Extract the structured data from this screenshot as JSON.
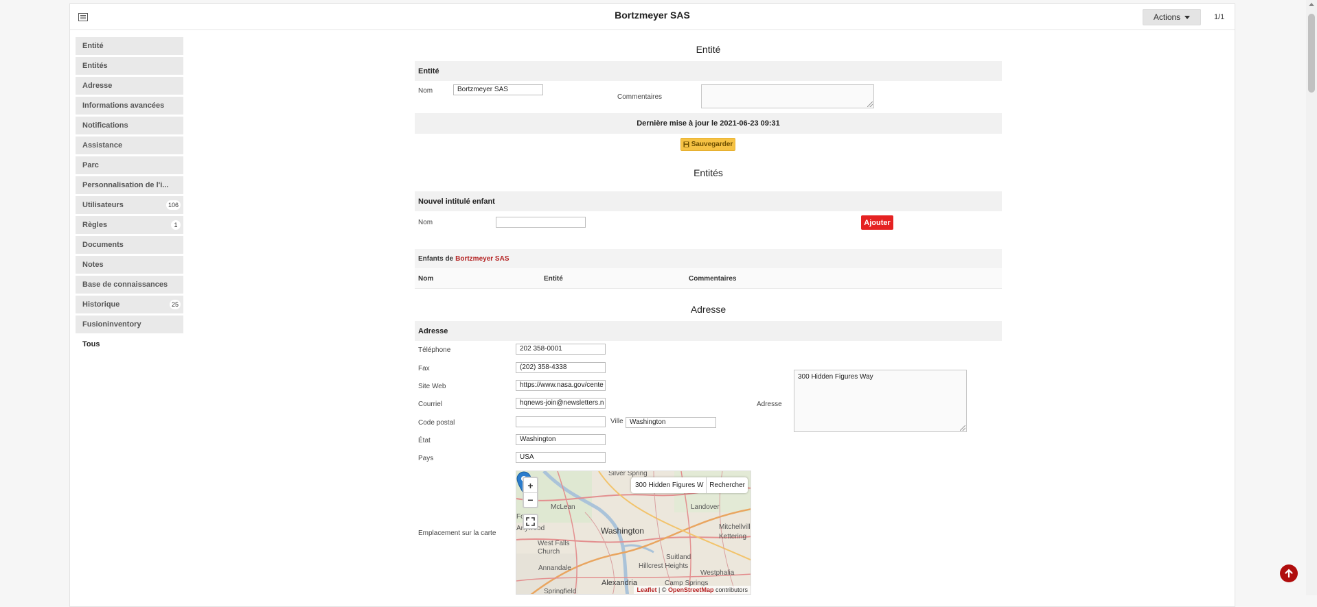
{
  "header": {
    "title": "Bortzmeyer SAS",
    "actions_label": "Actions",
    "pager": "1/1"
  },
  "sidebar": {
    "items": [
      {
        "label": "Entité"
      },
      {
        "label": "Entités"
      },
      {
        "label": "Adresse"
      },
      {
        "label": "Informations avancées"
      },
      {
        "label": "Notifications"
      },
      {
        "label": "Assistance"
      },
      {
        "label": "Parc"
      },
      {
        "label": "Personnalisation de l'i..."
      },
      {
        "label": "Utilisateurs",
        "badge": "106"
      },
      {
        "label": "Règles",
        "badge": "1"
      },
      {
        "label": "Documents"
      },
      {
        "label": "Notes"
      },
      {
        "label": "Base de connaissances"
      },
      {
        "label": "Historique",
        "badge": "25"
      },
      {
        "label": "Fusioninventory"
      },
      {
        "label": "Tous"
      }
    ]
  },
  "entite": {
    "section_title": "Entité",
    "band_label": "Entité",
    "name_label": "Nom",
    "name_value": "Bortzmeyer SAS",
    "comments_label": "Commentaires",
    "comments_value": "",
    "last_update": "Dernière mise à jour le 2021-06-23 09:31",
    "save_label": "Sauvegarder"
  },
  "entites": {
    "section_title": "Entités",
    "band_label": "Nouvel intitulé enfant",
    "name_label": "Nom",
    "name_value": "",
    "add_label": "Ajouter",
    "children_prefix": "Enfants de",
    "children_entity": "Bortzmeyer SAS",
    "columns": [
      "Nom",
      "Entité",
      "Commentaires"
    ]
  },
  "adresse": {
    "section_title": "Adresse",
    "band_label": "Adresse",
    "phone_label": "Téléphone",
    "phone_value": "202 358-0001",
    "fax_label": "Fax",
    "fax_value": "(202) 358-4338",
    "website_label": "Site Web",
    "website_value": "https://www.nasa.gov/cente",
    "email_label": "Courriel",
    "email_value": "hqnews-join@newsletters.n",
    "postal_label": "Code postal",
    "postal_value": "",
    "city_label": "Ville",
    "city_value": "Washington",
    "state_label": "État",
    "state_value": "Washington",
    "country_label": "Pays",
    "country_value": "USA",
    "address_label": "Adresse",
    "address_value": "300 Hidden Figures Way",
    "map_label": "Emplacement sur la carte"
  },
  "map": {
    "search_value": "300 Hidden Figures W",
    "search_button": "Rechercher",
    "zoom_in": "+",
    "zoom_out": "−",
    "attr_leaflet": "Leaflet",
    "attr_sep": " | © ",
    "attr_osm": "OpenStreetMap",
    "attr_suffix": " contributors",
    "places": [
      "Silver Spring",
      "McLean",
      "Landover",
      "Washington",
      "West Falls Church",
      "Mitchellville",
      "Kettering",
      "Suitland",
      "Hillcrest Heights",
      "Annandale",
      "Alexandria",
      "Westphalia",
      "Camp Springs",
      "Springfield",
      "Arlywood",
      "Forest"
    ]
  },
  "colors": {
    "accent_red": "#e52222",
    "save_yellow": "#f6c244",
    "link_red": "#b42222",
    "band_gray": "#f1f1f1"
  }
}
